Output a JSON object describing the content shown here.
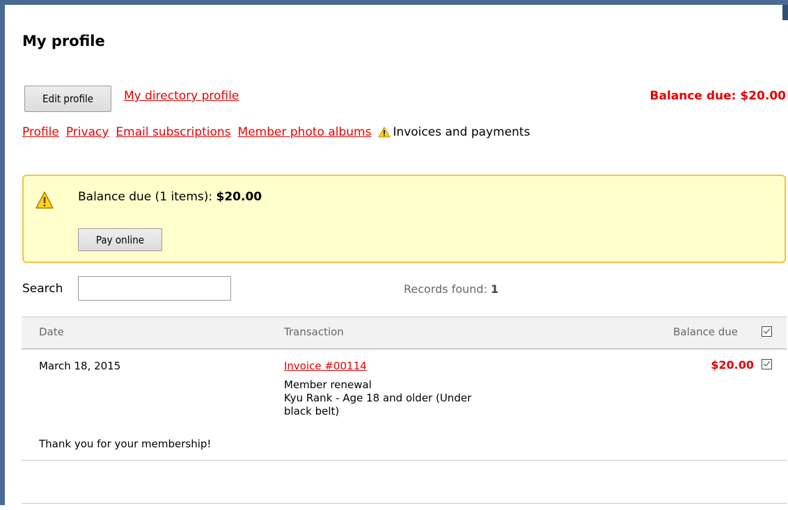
{
  "page": {
    "title": "My profile"
  },
  "header": {
    "edit_profile_label": "Edit profile",
    "directory_profile_label": "My directory profile",
    "balance_due_label": "Balance due: $20.00"
  },
  "tabs": [
    {
      "label": "Profile"
    },
    {
      "label": "Privacy"
    },
    {
      "label": "Email subscriptions"
    },
    {
      "label": "Member photo albums"
    },
    {
      "label": "Invoices and payments",
      "current": true
    }
  ],
  "alert": {
    "text_prefix": "Balance due (1 items):",
    "amount": "$20.00",
    "pay_label": "Pay online"
  },
  "search": {
    "label": "Search",
    "value": "",
    "records_label": "Records found:",
    "records_count": "1"
  },
  "table": {
    "headers": {
      "date": "Date",
      "transaction": "Transaction",
      "balance_due": "Balance due"
    },
    "rows": [
      {
        "date": "March 18, 2015",
        "invoice_link": "Invoice #00114",
        "description_line1": "Member renewal",
        "description_line2": "Kyu Rank - Age 18 and older (Under",
        "description_line3": "black belt)",
        "amount": "$20.00",
        "note": "Thank you for your membership!",
        "checked": true
      }
    ]
  },
  "colors": {
    "frame_border": "#4a6a94",
    "link_red": "#e60000",
    "alert_bg": "#ffffcc",
    "alert_border": "#f5c242"
  }
}
